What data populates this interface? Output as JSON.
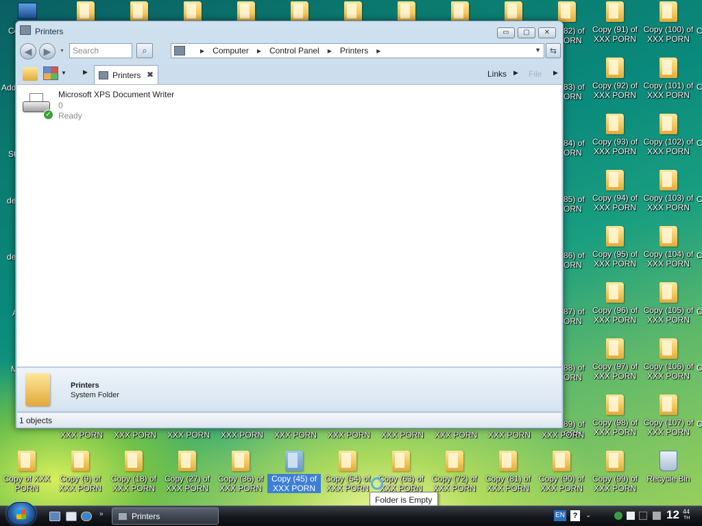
{
  "desktop": {
    "right_column_1": [
      {
        "label": "Copy (91) of\nXXX PORN"
      },
      {
        "label": "Copy (92) of\nXXX PORN"
      },
      {
        "label": "Copy (93) of\nXXX PORN"
      },
      {
        "label": "Copy (94) of\nXXX PORN"
      },
      {
        "label": "Copy (95) of\nXXX PORN"
      },
      {
        "label": "Copy (96) of\nXXX PORN"
      },
      {
        "label": "Copy (97) of\nXXX PORN"
      },
      {
        "label": "Copy (98) of\nXXX PORN"
      },
      {
        "label": "Copy (99) of\nXXX PORN"
      }
    ],
    "right_column_2": [
      {
        "label": "Copy (100) of\nXXX PORN"
      },
      {
        "label": "Copy (101) of\nXXX PORN"
      },
      {
        "label": "Copy (102) of\nXXX PORN"
      },
      {
        "label": "Copy (103) of\nXXX PORN"
      },
      {
        "label": "Copy (104) of\nXXX PORN"
      },
      {
        "label": "Copy (105) of\nXXX PORN"
      },
      {
        "label": "Copy (106) of\nXXX PORN"
      },
      {
        "label": "Copy (107) of\nXXX PORN"
      }
    ],
    "partial_column": [
      "82) of\nORN",
      "83) of\nORN",
      "84) of\nORN",
      "85) of\nORN",
      "86) of\nORN",
      "87) of\nORN",
      "88) of\nORN",
      "89) of\nORN"
    ],
    "bottom_row": [
      {
        "label": "Copy of XXX\nPORN"
      },
      {
        "label": "Copy (9) of\nXXX PORN"
      },
      {
        "label": "Copy (18) of\nXXX PORN"
      },
      {
        "label": "Copy (27) of\nXXX PORN"
      },
      {
        "label": "Copy (36) of\nXXX PORN"
      },
      {
        "label": "Copy (45) of\nXXX PORN"
      },
      {
        "label": "Copy (54) of\nXXX PORN"
      },
      {
        "label": "Copy (63) of\nXXX PORN"
      },
      {
        "label": "Copy (72) of\nXXX PORN"
      },
      {
        "label": "Copy (81) of\nXXX PORN"
      },
      {
        "label": "Copy (90) of\nXXX PORN"
      },
      {
        "label": "Copy (99) of\nXXX PORN"
      }
    ],
    "second_row_labels": [
      "XXX PORN",
      "XXX PORN",
      "XXX PORN",
      "XXX PORN",
      "XXX PORN",
      "XXX PORN",
      "XXX PORN",
      "XXX PORN",
      "XXX PORN",
      "XXX PORN"
    ],
    "recycle_bin": "Recycle Bin",
    "left_fragments": [
      "Co",
      "Add",
      "St",
      "de",
      "de",
      "A",
      "M"
    ],
    "right_fragments": [
      "C",
      "C",
      "C",
      "C",
      "C",
      "C",
      "C",
      "C"
    ]
  },
  "window": {
    "title": "Printers",
    "minimize": "▭",
    "maximize": "▢",
    "close": "✕",
    "search_placeholder": "Search",
    "breadcrumb": [
      "Computer",
      "Control Panel",
      "Printers"
    ],
    "tab_label": "Printers",
    "links_label": "Links",
    "file_label": "File",
    "item": {
      "name": "Microsoft XPS Document Writer",
      "jobs": "0",
      "status": "Ready"
    },
    "details": {
      "name": "Printers",
      "type": "System Folder"
    },
    "status_text": "1 objects"
  },
  "tooltip": "Folder is Empty",
  "taskbar": {
    "task_label": "Printers",
    "language": "EN",
    "clock_hour": "12",
    "clock_minute": "44",
    "clock_suffix": "TH"
  }
}
